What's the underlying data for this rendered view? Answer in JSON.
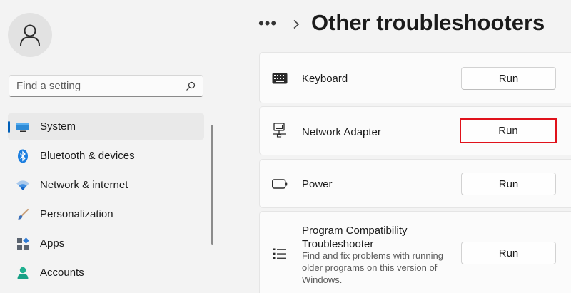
{
  "sidebar": {
    "search": {
      "placeholder": "Find a setting"
    },
    "items": [
      {
        "label": "System",
        "icon": "system-display-icon",
        "active": true
      },
      {
        "label": "Bluetooth & devices",
        "icon": "bluetooth-icon"
      },
      {
        "label": "Network & internet",
        "icon": "wifi-icon"
      },
      {
        "label": "Personalization",
        "icon": "brush-icon"
      },
      {
        "label": "Apps",
        "icon": "apps-icon"
      },
      {
        "label": "Accounts",
        "icon": "account-icon"
      }
    ]
  },
  "header": {
    "more": "•••",
    "title": "Other troubleshooters"
  },
  "troubleshooters": [
    {
      "name": "Keyboard",
      "icon": "keyboard-icon",
      "button": "Run"
    },
    {
      "name": "Network Adapter",
      "icon": "network-adapter-icon",
      "button": "Run",
      "highlighted": true
    },
    {
      "name": "Power",
      "icon": "battery-icon",
      "button": "Run"
    },
    {
      "name": "Program Compatibility Troubleshooter",
      "icon": "list-icon",
      "button": "Run",
      "description": "Find and fix problems with running older programs on this version of Windows."
    }
  ],
  "colors": {
    "accent": "#005fb8",
    "highlight_border": "#e0121b",
    "background": "#f3f3f3",
    "card": "#fbfbfb"
  }
}
